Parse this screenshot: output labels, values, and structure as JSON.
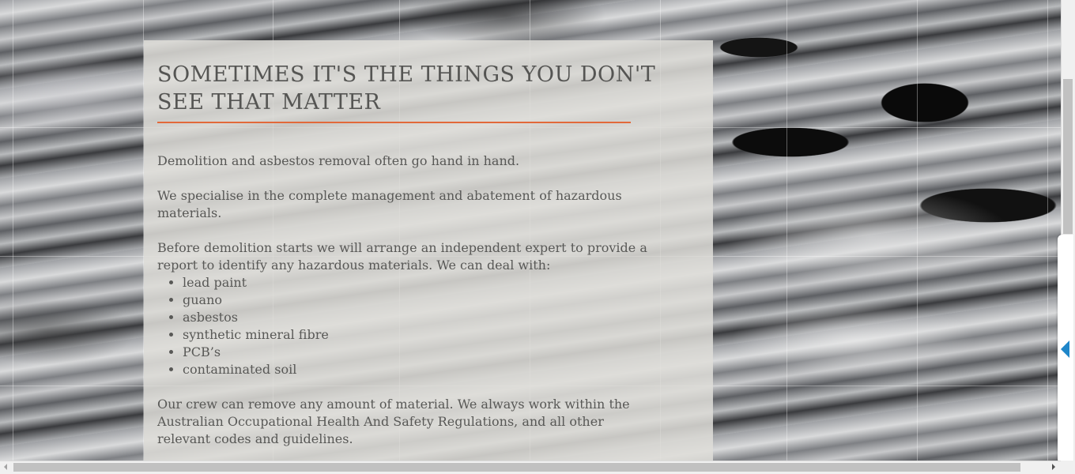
{
  "content": {
    "heading": "SOMETIMES IT'S THE THINGS YOU DON'T SEE THAT MATTER",
    "paragraph_1": "Demolition and asbestos removal often go hand in hand.",
    "paragraph_2": "We specialise in the complete management and abatement of hazardous materials.",
    "paragraph_3": "Before demolition starts we will arrange an independent expert to provide a report to identify any hazardous materials. We can deal with:",
    "hazards": [
      "lead paint",
      "guano",
      "asbestos",
      "synthetic mineral fibre",
      "PCB’s",
      "contaminated soil"
    ],
    "paragraph_4": "Our crew can remove any amount of material. We always work within the Australian Occupational Health And Safety Regulations, and all other relevant codes and guidelines."
  },
  "colors": {
    "accent_rule": "#e2693a",
    "panel_bg": "#dedd d8",
    "side_tab_arrow": "#1f86c9"
  },
  "icons": {
    "side_tab": "triangle-left-icon",
    "scroll_left": "scroll-left-arrow-icon",
    "scroll_right": "scroll-right-arrow-icon"
  }
}
